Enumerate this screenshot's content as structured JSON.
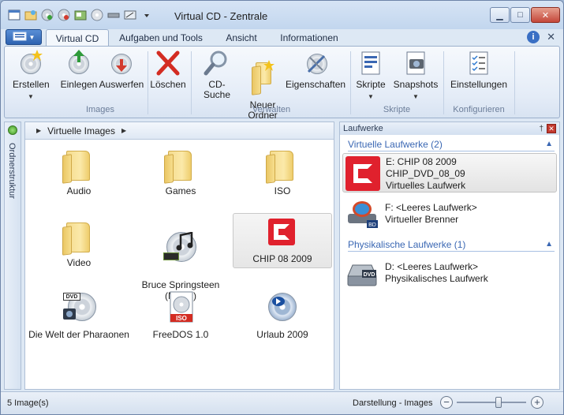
{
  "window": {
    "title": "Virtual CD - Zentrale",
    "colors": {
      "accent": "#3a67b3",
      "chip_red": "#e0212d",
      "close": "#c4473a"
    }
  },
  "quick_access": [
    "app-icon",
    "folder-icon",
    "disc-add-icon",
    "disc-eject-icon",
    "image-icon",
    "disc-icon",
    "drive-icon",
    "settings-icon",
    "dropdown-icon"
  ],
  "tabs": [
    {
      "label": "Virtual CD",
      "active": true
    },
    {
      "label": "Aufgaben und Tools",
      "active": false
    },
    {
      "label": "Ansicht",
      "active": false
    },
    {
      "label": "Informationen",
      "active": false
    }
  ],
  "ribbon": {
    "groups": [
      {
        "label": "Images"
      },
      {
        "label": "Verwalten"
      },
      {
        "label": "Skripte"
      },
      {
        "label": "Konfigurieren"
      }
    ],
    "buttons": {
      "erstellen": "Erstellen",
      "einlegen": "Einlegen",
      "auswerfen": "Auswerfen",
      "loeschen": "Löschen",
      "cdsuche": "CD-Suche",
      "neuer_ordner": "Neuer\nOrdner",
      "eigenschaften": "Eigenschaften",
      "skripte": "Skripte",
      "snapshots": "Snapshots",
      "einstellungen": "Einstellungen"
    }
  },
  "left_strip": {
    "label": "Ordnerstruktur"
  },
  "breadcrumb": {
    "label": "Virtuelle Images"
  },
  "images": [
    {
      "label": "Audio",
      "type": "folder"
    },
    {
      "label": "Games",
      "type": "folder"
    },
    {
      "label": "ISO",
      "type": "folder"
    },
    {
      "label": "Video",
      "type": "folder"
    },
    {
      "label": "Bruce Springsteen\n(Magic)",
      "type": "music-disc"
    },
    {
      "label": "CHIP 08 2009",
      "type": "chip",
      "selected": true
    },
    {
      "label": "Die Welt der Pharaonen",
      "type": "dvd-disc"
    },
    {
      "label": "FreeDOS 1.0",
      "type": "iso-disc"
    },
    {
      "label": "Urlaub 2009",
      "type": "bluray-disc"
    }
  ],
  "drives_pane": {
    "title": "Laufwerke",
    "virtual_section": "Virtuelle Laufwerke (2)",
    "physical_section": "Physikalische Laufwerke (1)",
    "virtual": [
      {
        "line1": "E: CHIP 08 2009",
        "line2": "CHIP_DVD_08_09",
        "line3": "Virtuelles Laufwerk",
        "selected": true
      },
      {
        "line1": "F: <Leeres Laufwerk>",
        "line2": "Virtueller Brenner"
      }
    ],
    "physical": [
      {
        "line1": "D: <Leeres Laufwerk>",
        "line2": "Physikalisches Laufwerk"
      }
    ]
  },
  "status": {
    "count": "5 Image(s)",
    "view": "Darstellung - Images",
    "zoom_fraction": 0.6
  }
}
